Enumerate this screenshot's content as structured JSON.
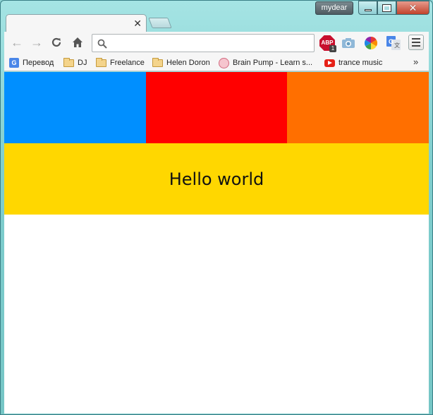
{
  "window": {
    "profile_name": "mydear",
    "controls": [
      "minimize",
      "maximize",
      "close"
    ]
  },
  "tabs": [
    {
      "title": "",
      "active": true
    },
    {
      "title": "",
      "active": false,
      "kind": "new-tab"
    }
  ],
  "toolbar": {
    "omnibox_value": "",
    "extensions": [
      "adblock-plus",
      "screenshot-camera",
      "color-wheel",
      "google-translate"
    ],
    "abp_badge": "1",
    "abp_label": "ABP"
  },
  "bookmarks": [
    {
      "label": "Перевод",
      "icon": "google-translate-icon"
    },
    {
      "label": "DJ",
      "icon": "folder-icon"
    },
    {
      "label": "Freelance",
      "icon": "folder-icon"
    },
    {
      "label": "Helen Doron",
      "icon": "folder-icon"
    },
    {
      "label": "Brain Pump - Learn s...",
      "icon": "brain-icon"
    },
    {
      "label": "trance music",
      "icon": "youtube-icon"
    }
  ],
  "bookmarks_overflow": "»",
  "page": {
    "blocks": [
      {
        "color": "#008FFF"
      },
      {
        "color": "#FF0000"
      },
      {
        "color": "#FF6F00"
      }
    ],
    "banner_color": "#FFD700",
    "heading": "Hello world"
  },
  "colors": {
    "frame": "#7FCECE",
    "toolbar": "#F6F6F6",
    "close_button": "#C2432C"
  }
}
